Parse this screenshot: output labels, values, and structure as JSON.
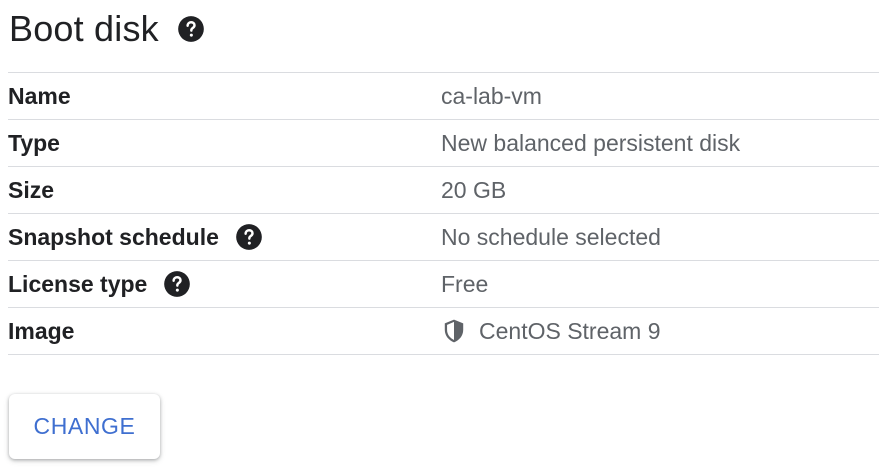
{
  "header": {
    "title": "Boot disk",
    "help_icon": "help-circle-icon"
  },
  "details": {
    "rows": [
      {
        "label": "Name",
        "value": "ca-lab-vm",
        "help": false
      },
      {
        "label": "Type",
        "value": "New balanced persistent disk",
        "help": false
      },
      {
        "label": "Size",
        "value": "20 GB",
        "help": false
      },
      {
        "label": "Snapshot schedule",
        "value": "No schedule selected",
        "help": true
      },
      {
        "label": "License type",
        "value": "Free",
        "help": true
      },
      {
        "label": "Image",
        "value": "CentOS Stream 9",
        "help": false,
        "value_icon": "shield-icon"
      }
    ]
  },
  "actions": {
    "change_label": "CHANGE"
  },
  "colors": {
    "text_primary": "#202124",
    "text_secondary": "#5f6368",
    "divider": "#dadce0",
    "accent": "#3f6fd0"
  }
}
